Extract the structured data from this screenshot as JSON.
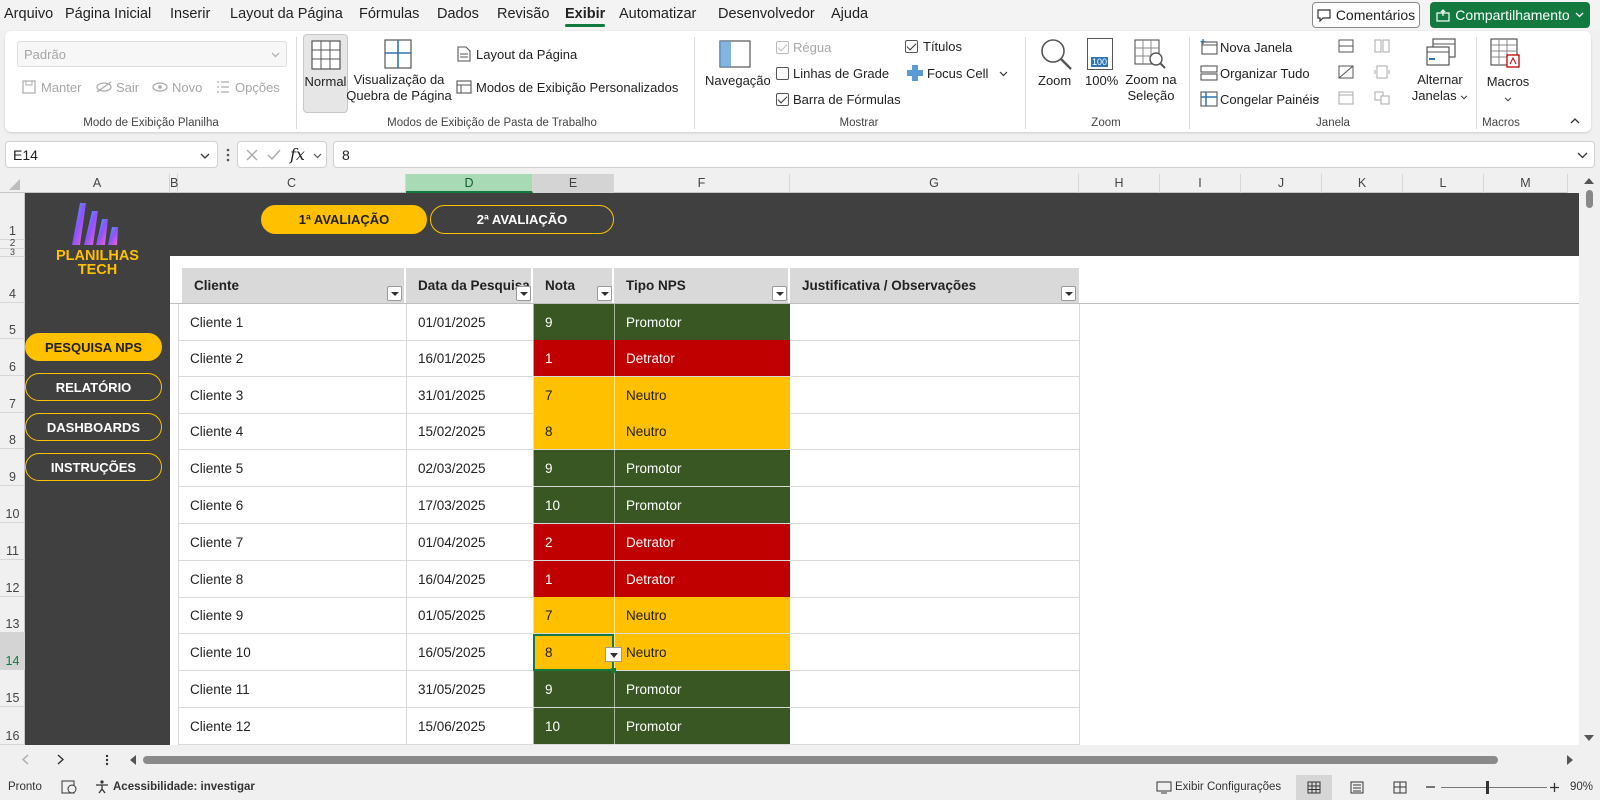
{
  "menu": {
    "items": [
      "Arquivo",
      "Página Inicial",
      "Inserir",
      "Layout da Página",
      "Fórmulas",
      "Dados",
      "Revisão",
      "Exibir",
      "Automatizar",
      "Desenvolvedor",
      "Ajuda"
    ],
    "active": "Exibir",
    "comments_label": "Comentários",
    "share_label": "Compartilhamento"
  },
  "ribbon": {
    "sheet_view": {
      "select_value": "Padrão",
      "keep": "Manter",
      "exit": "Sair",
      "new": "Novo",
      "options": "Opções",
      "group": "Modo de Exibição Planilha"
    },
    "workbook_views": {
      "normal": "Normal",
      "page_break_1": "Visualização da",
      "page_break_2": "Quebra de Página",
      "page_layout": "Layout da Página",
      "custom_views": "Modos de Exibição Personalizados",
      "group": "Modos de Exibição de Pasta de Trabalho"
    },
    "show": {
      "navigation": "Navegação",
      "ruler": "Régua",
      "gridlines": "Linhas de Grade",
      "formula_bar": "Barra de Fórmulas",
      "headings": "Títulos",
      "focus_cell": "Focus Cell",
      "group": "Mostrar"
    },
    "zoom": {
      "zoom": "Zoom",
      "zoom_100": "100%",
      "icon_100": "100",
      "zoom_sel_1": "Zoom na",
      "zoom_sel_2": "Seleção",
      "group": "Zoom"
    },
    "window": {
      "new_window": "Nova Janela",
      "arrange_all": "Organizar Tudo",
      "freeze": "Congelar Painéis",
      "switch_1": "Alternar",
      "switch_2": "Janelas",
      "group": "Janela"
    },
    "macros": {
      "macros": "Macros",
      "group": "Macros"
    }
  },
  "formula_bar": {
    "name_box": "E14",
    "value": "8"
  },
  "columns": [
    "A",
    "B",
    "C",
    "D",
    "E",
    "F",
    "G",
    "H",
    "I",
    "J",
    "K",
    "L",
    "M"
  ],
  "rows": [
    "1",
    "2",
    "3",
    "4",
    "5",
    "6",
    "7",
    "8",
    "9",
    "10",
    "11",
    "12",
    "13",
    "14",
    "15",
    "16"
  ],
  "sheet": {
    "logo_line1": "PLANILHAS",
    "logo_line2": "TECH",
    "tabs": [
      "1ª AVALIAÇÃO",
      "2ª AVALIAÇÃO"
    ],
    "nav": [
      "PESQUISA NPS",
      "RELATÓRIO",
      "DASHBOARDS",
      "INSTRUÇÕES"
    ],
    "headers": [
      "Cliente",
      "Data da Pesquisa",
      "Nota",
      "Tipo NPS",
      "Justificativa / Observações"
    ],
    "records": [
      {
        "client": "Cliente 1",
        "date": "01/01/2025",
        "score": "9",
        "type": "Promotor"
      },
      {
        "client": "Cliente 2",
        "date": "16/01/2025",
        "score": "1",
        "type": "Detrator"
      },
      {
        "client": "Cliente 3",
        "date": "31/01/2025",
        "score": "7",
        "type": "Neutro"
      },
      {
        "client": "Cliente 4",
        "date": "15/02/2025",
        "score": "8",
        "type": "Neutro"
      },
      {
        "client": "Cliente 5",
        "date": "02/03/2025",
        "score": "9",
        "type": "Promotor"
      },
      {
        "client": "Cliente 6",
        "date": "17/03/2025",
        "score": "10",
        "type": "Promotor"
      },
      {
        "client": "Cliente 7",
        "date": "01/04/2025",
        "score": "2",
        "type": "Detrator"
      },
      {
        "client": "Cliente 8",
        "date": "16/04/2025",
        "score": "1",
        "type": "Detrator"
      },
      {
        "client": "Cliente 9",
        "date": "01/05/2025",
        "score": "7",
        "type": "Neutro"
      },
      {
        "client": "Cliente 10",
        "date": "16/05/2025",
        "score": "8",
        "type": "Neutro"
      },
      {
        "client": "Cliente 11",
        "date": "31/05/2025",
        "score": "9",
        "type": "Promotor"
      },
      {
        "client": "Cliente 12",
        "date": "15/06/2025",
        "score": "10",
        "type": "Promotor"
      }
    ]
  },
  "colors": {
    "promotor": "#385723",
    "detrator": "#c00000",
    "neutro": "#ffc000",
    "accent": "#137a3f",
    "dark_panel": "#404040"
  },
  "status": {
    "ready": "Pronto",
    "accessibility": "Acessibilidade: investigar",
    "display_settings": "Exibir Configurações",
    "zoom": "90%"
  }
}
